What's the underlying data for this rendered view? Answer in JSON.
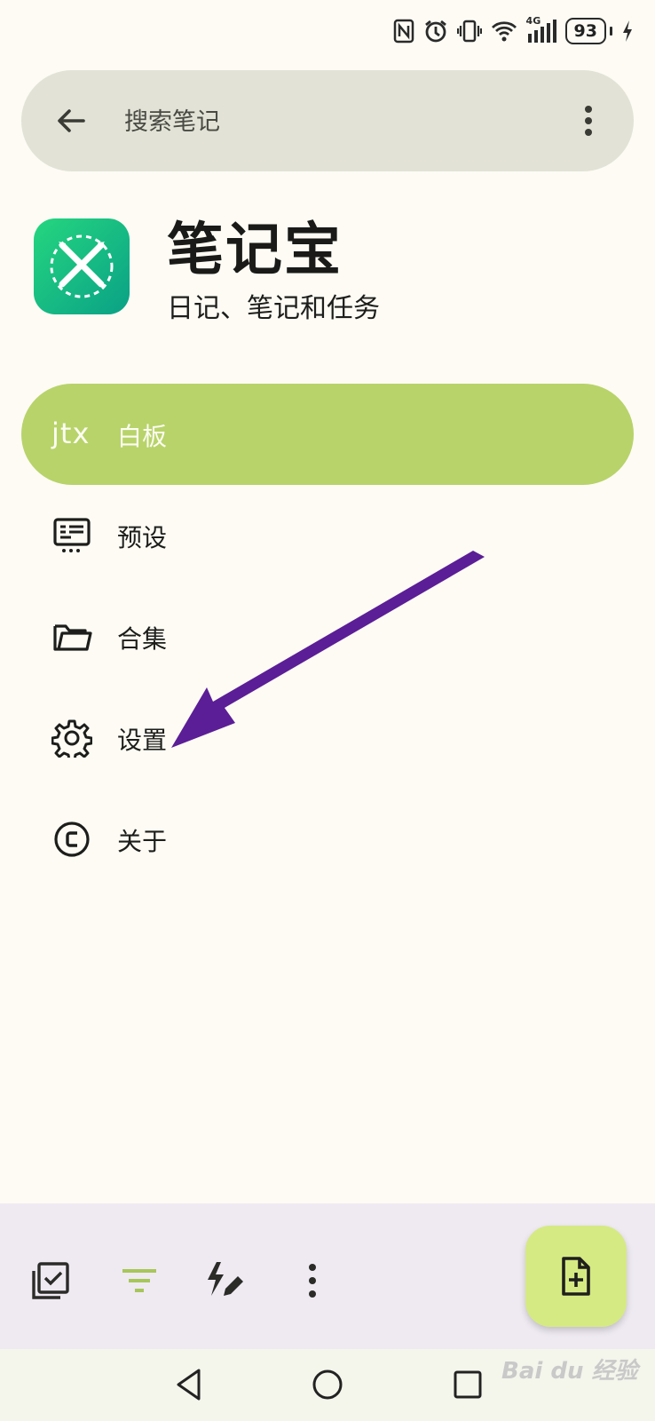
{
  "status_bar": {
    "battery_level": "93",
    "network_label": "4G",
    "icons": [
      "nfc-icon",
      "alarm-icon",
      "vibrate-icon",
      "wifi-icon",
      "signal-icon",
      "battery-icon",
      "charging-icon"
    ]
  },
  "search": {
    "placeholder": "搜索笔记",
    "back_icon": "arrow-back-icon",
    "menu_icon": "more-vert-icon"
  },
  "app": {
    "name": "笔记宝",
    "subtitle": "日记、笔记和任务",
    "icon": "notes-app-icon"
  },
  "drawer": {
    "items": [
      {
        "label": "白板",
        "icon": "jtx-logo-icon",
        "active": true,
        "logo_text": "jtx"
      },
      {
        "label": "预设",
        "icon": "presets-icon",
        "active": false
      },
      {
        "label": "合集",
        "icon": "folder-icon",
        "active": false
      },
      {
        "label": "设置",
        "icon": "gear-icon",
        "active": false
      },
      {
        "label": "关于",
        "icon": "copyright-icon",
        "active": false
      }
    ]
  },
  "bottom_bar": {
    "icons": [
      "checklist-icon",
      "filter-icon",
      "quick-add-icon",
      "more-vert-icon"
    ],
    "fab_icon": "new-note-icon"
  },
  "system_nav": {
    "icons": [
      "back-triangle-icon",
      "home-circle-icon",
      "recents-square-icon"
    ]
  },
  "watermark": {
    "text": "Bai du 经验"
  },
  "colors": {
    "background": "#fdfbf4",
    "search_bar": "#e2e3d6",
    "active_item": "#b8d36a",
    "bottom_bar": "#efeaf2",
    "fab": "#d5ea82",
    "annotation_arrow": "#5b1e96",
    "app_icon_gradient": [
      "#25d67f",
      "#0aa186"
    ]
  }
}
